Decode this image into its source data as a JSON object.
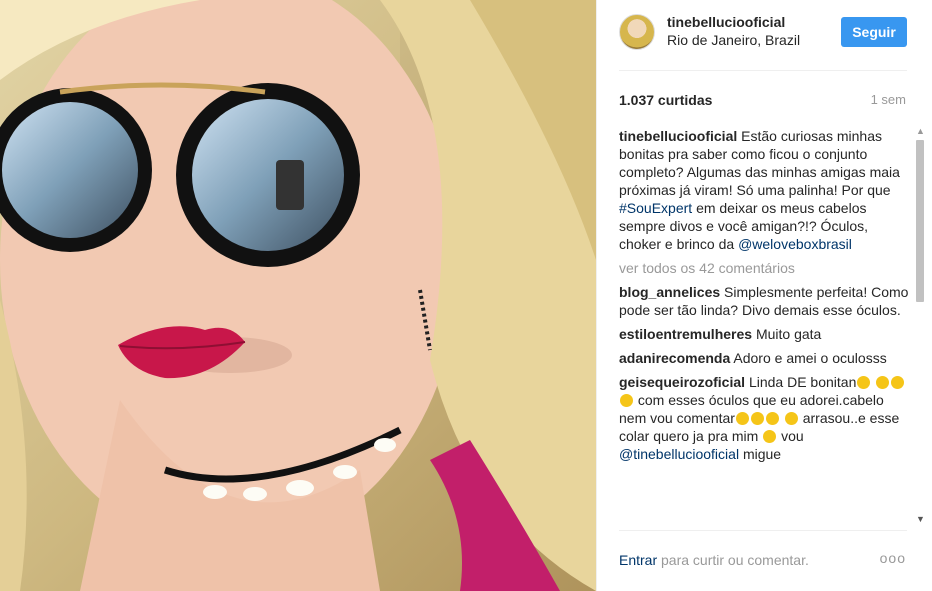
{
  "post": {
    "username": "tinebelluciooficial",
    "location": "Rio de Janeiro, Brazil",
    "follow_label": "Seguir",
    "likes": "1.037 curtidas",
    "time_ago": "1 sem"
  },
  "caption": {
    "username": "tinebelluciooficial",
    "text_1": "Estão curiosas minhas bonitas pra saber como ficou o conjunto completo? Algumas das minhas amigas maia próximas já viram! Só uma palinha! Por que",
    "hashtag": "#SouExpert",
    "text_2": "em deixar os meus cabelos sempre divos e você amigan?!? Óculos, choker e brinco da",
    "mention": "@weloveboxbrasil"
  },
  "view_all": "ver todos os 42 comentários",
  "comments": [
    {
      "username": "blog_annelices",
      "text": "Simplesmente perfeita! Como pode ser tão linda? Divo demais esse óculos."
    },
    {
      "username": "estiloentremulheres",
      "text": "Muito gata"
    },
    {
      "username": "adanirecomenda",
      "text": "Adoro e amei o oculosss"
    },
    {
      "username": "geisequeirozoficial",
      "text_1": "Linda DE bonitan",
      "text_2": "com esses óculos que eu adorei.cabelo nem vou comentar",
      "text_3": "arrasou..e esse colar quero ja pra mim",
      "text_4": "vou",
      "mention": "@tinebelluciooficial",
      "text_5": "migue"
    }
  ],
  "footer": {
    "login_link": "Entrar",
    "text": "para curtir ou comentar.",
    "more_label": "ooo"
  },
  "colors": {
    "accent": "#3897f0",
    "link": "#003569",
    "muted": "#999999",
    "lips": "#c8174a"
  }
}
